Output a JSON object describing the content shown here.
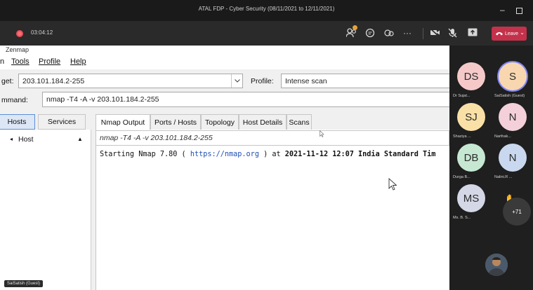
{
  "window": {
    "title": "ATAL FDP - Cyber Security (08/11/2021 to 12/11/2021)",
    "min_icon": "minimize-icon",
    "max_icon": "maximize-icon"
  },
  "meeting": {
    "timer": "03:04:12",
    "leave_label": "Leave",
    "toolbar_icons": [
      "participants-icon",
      "chat-icon",
      "reactions-icon",
      "more-icon",
      "camera-off-icon",
      "mic-off-icon",
      "share-icon"
    ]
  },
  "zenmap": {
    "window_title": "Zenmap",
    "menu": [
      "n",
      "Tools",
      "Profile",
      "Help"
    ],
    "target_label": "get:",
    "target_value": "203.101.184.2-255",
    "profile_label": "Profile:",
    "profile_value": "Intense scan",
    "command_label": "mmand:",
    "command_value": "nmap -T4 -A -v 203.101.184.2-255",
    "side_tabs": [
      "Hosts",
      "Services"
    ],
    "host_header": "Host",
    "tabs": [
      "Nmap Output",
      "Ports / Hosts",
      "Topology",
      "Host Details",
      "Scans"
    ],
    "output_command": "nmap -T4 -A -v 203.101.184.2-255",
    "output_line": {
      "prefix": "Starting Nmap 7.80 ( ",
      "url": "https://nmap.org",
      "suffix": " ) at ",
      "bold": "2021-11-12 12:07 India Standard Tim"
    },
    "presenter_tag": "SaiSatish (Guest)"
  },
  "participants": [
    {
      "initials": "DS",
      "name": "Dr Sujat...",
      "color": "#f6c9c9",
      "speaking": false
    },
    {
      "initials": "S",
      "name": "SaiSatish (Guest)",
      "color": "#f8d7b0",
      "speaking": true
    },
    {
      "initials": "SJ",
      "name": "Shaziya ...",
      "color": "#f9e0a6",
      "speaking": false
    },
    {
      "initials": "N",
      "name": "Narthak...",
      "color": "#f3d0da",
      "speaking": false
    },
    {
      "initials": "DB",
      "name": "Durga B...",
      "color": "#c6e8d2",
      "speaking": false
    },
    {
      "initials": "N",
      "name": "Nalini.R ...",
      "color": "#c9d8ef",
      "speaking": false
    },
    {
      "initials": "MS",
      "name": "Ms. B. S...",
      "color": "#d4d7e6",
      "speaking": false
    }
  ],
  "more_count": "+71"
}
